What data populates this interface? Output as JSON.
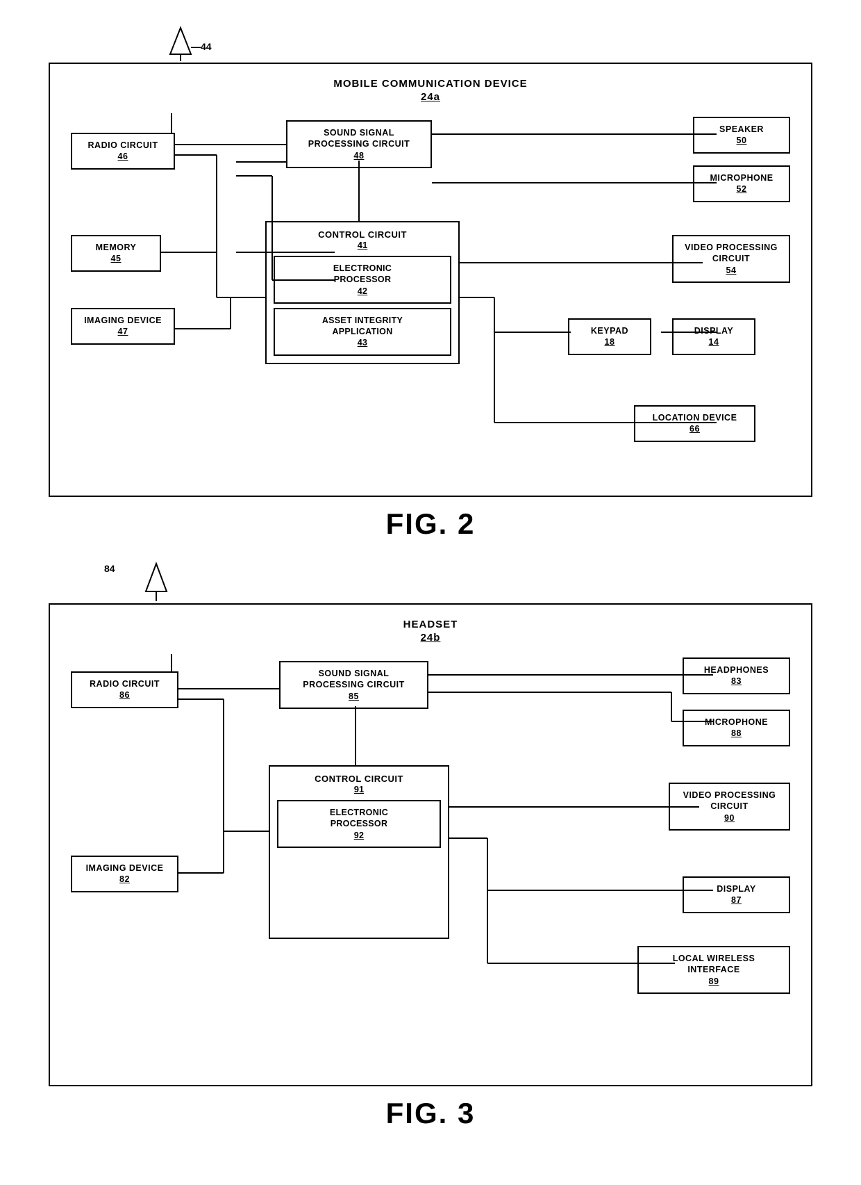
{
  "fig2": {
    "title": "MOBILE COMMUNICATION DEVICE",
    "subtitle": "24a",
    "antenna_ref": "44",
    "components": {
      "radio_circuit": {
        "label": "RADIO CIRCUIT",
        "ref": "46"
      },
      "memory": {
        "label": "MEMORY",
        "ref": "45"
      },
      "imaging_device": {
        "label": "IMAGING DEVICE",
        "ref": "47"
      },
      "sound_signal": {
        "label": "SOUND SIGNAL\nPROCESSING CIRCUIT",
        "ref": "48"
      },
      "control_circuit": {
        "label": "CONTROL CIRCUIT",
        "ref": "41"
      },
      "electronic_processor": {
        "label": "ELECTRONIC\nPROCESSOR",
        "ref": "42"
      },
      "asset_integrity": {
        "label": "ASSET INTEGRITY\nAPPLICATION",
        "ref": "43"
      },
      "speaker": {
        "label": "SPEAKER",
        "ref": "50"
      },
      "microphone": {
        "label": "MICROPHONE",
        "ref": "52"
      },
      "video_processing": {
        "label": "VIDEO PROCESSING\nCIRCUIT",
        "ref": "54"
      },
      "keypad": {
        "label": "KEYPAD",
        "ref": "18"
      },
      "display": {
        "label": "DISPLAY",
        "ref": "14"
      },
      "location_device": {
        "label": "LOCATION DEVICE",
        "ref": "66"
      }
    }
  },
  "fig2_label": "FIG. 2",
  "fig3": {
    "title": "HEADSET",
    "subtitle": "24b",
    "antenna_ref": "84",
    "components": {
      "radio_circuit": {
        "label": "RADIO CIRCUIT",
        "ref": "86"
      },
      "imaging_device": {
        "label": "IMAGING DEVICE",
        "ref": "82"
      },
      "sound_signal": {
        "label": "SOUND SIGNAL\nPROCESSING CIRCUIT",
        "ref": "85"
      },
      "control_circuit": {
        "label": "CONTROL CIRCUIT",
        "ref": "91"
      },
      "electronic_processor": {
        "label": "ELECTRONIC\nPROCESSOR",
        "ref": "92"
      },
      "headphones": {
        "label": "HEADPHONES",
        "ref": "83"
      },
      "microphone": {
        "label": "MICROPHONE",
        "ref": "88"
      },
      "video_processing": {
        "label": "VIDEO PROCESSING\nCIRCUIT",
        "ref": "90"
      },
      "display": {
        "label": "DISPLAY",
        "ref": "87"
      },
      "local_wireless": {
        "label": "LOCAL WIRELESS INTERFACE",
        "ref": "89"
      }
    }
  },
  "fig3_label": "FIG. 3"
}
